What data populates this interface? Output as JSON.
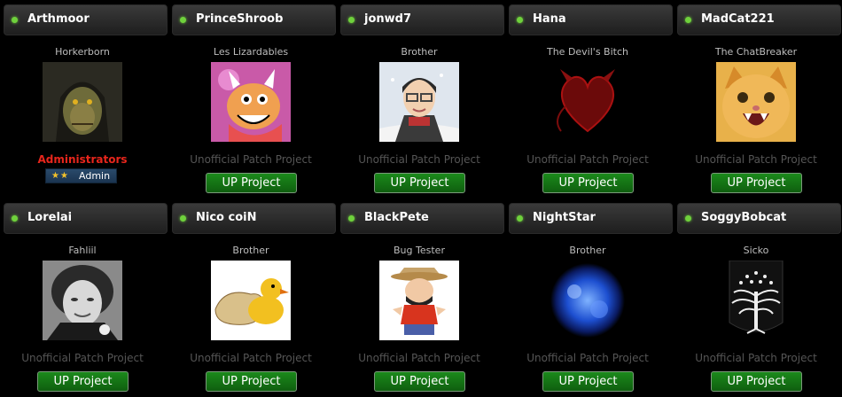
{
  "members": [
    {
      "username": "Arthmoor",
      "title": "Horkerborn",
      "avatar": "lizard-warrior-avatar",
      "group": "Administrators",
      "badge": {
        "stars": "★★",
        "label": "Admin"
      }
    },
    {
      "username": "PrinceShroob",
      "title": "Les Lizardables",
      "avatar": "bowser-avatar",
      "group": "Unofficial Patch Project",
      "button": "UP Project"
    },
    {
      "username": "jonwd7",
      "title": "Brother",
      "avatar": "cartoon-man-glasses-avatar",
      "group": "Unofficial Patch Project",
      "button": "UP Project"
    },
    {
      "username": "Hana",
      "title": "The Devil's Bitch",
      "avatar": "devil-heart-avatar",
      "group": "Unofficial Patch Project",
      "button": "UP Project"
    },
    {
      "username": "MadCat221",
      "title": "The ChatBreaker",
      "avatar": "orange-kitten-avatar",
      "group": "Unofficial Patch Project",
      "button": "UP Project"
    },
    {
      "username": "Lorelai",
      "title": "Fahliil",
      "avatar": "woman-bw-photo-avatar",
      "group": "Unofficial Patch Project",
      "button": "UP Project"
    },
    {
      "username": "Nico coiN",
      "title": "Brother",
      "avatar": "rubber-duck-avatar",
      "group": "Unofficial Patch Project",
      "button": "UP Project"
    },
    {
      "username": "BlackPete",
      "title": "Bug Tester",
      "avatar": "cartoon-cowboy-pete-avatar",
      "group": "Unofficial Patch Project",
      "button": "UP Project"
    },
    {
      "username": "NightStar",
      "title": "Brother",
      "avatar": "blue-sun-avatar",
      "group": "Unofficial Patch Project",
      "button": "UP Project"
    },
    {
      "username": "SoggyBobcat",
      "title": "Sicko",
      "avatar": "white-tree-avatar",
      "group": "Unofficial Patch Project",
      "button": "UP Project"
    }
  ],
  "colors": {
    "online_dot": "#6fd13c",
    "admin_group": "#e8261c",
    "button_green": "#1b8a1b",
    "muted_group": "#555555"
  }
}
